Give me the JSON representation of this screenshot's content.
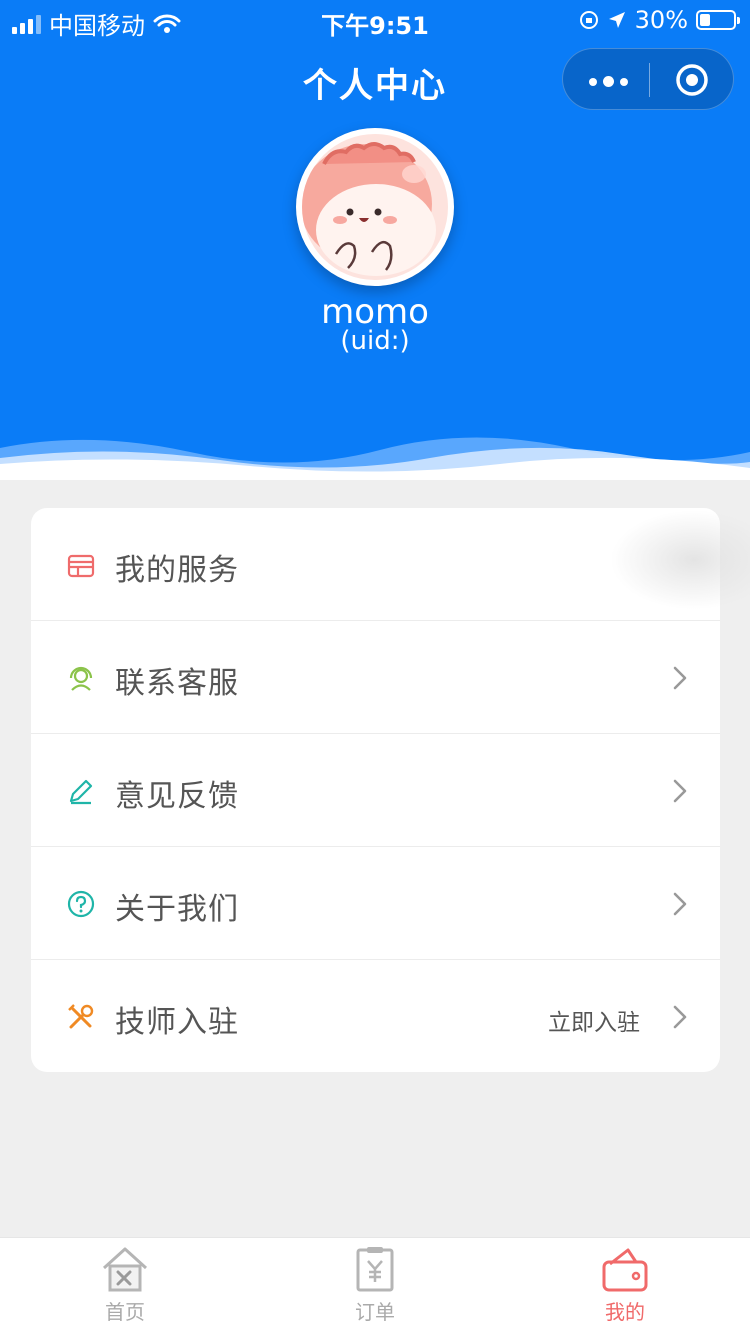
{
  "status_bar": {
    "carrier": "中国移动",
    "time": "下午9:51",
    "battery": "30%",
    "battery_level": 0.3
  },
  "nav": {
    "title": "个人中心"
  },
  "profile": {
    "username": "momo",
    "uid": "(uid:)"
  },
  "menu": [
    {
      "label": "我的服务",
      "icon": "store-icon",
      "color": "#ef6b6b"
    },
    {
      "label": "联系客服",
      "icon": "headset-icon",
      "color": "#8bc34a"
    },
    {
      "label": "意见反馈",
      "icon": "pencil-icon",
      "color": "#1fb5a8"
    },
    {
      "label": "关于我们",
      "icon": "question-icon",
      "color": "#1fb5a8"
    },
    {
      "label": "技师入驻",
      "icon": "tools-icon",
      "color": "#f08a24",
      "extra": "立即入驻"
    }
  ],
  "tabbar": [
    {
      "label": "首页",
      "icon": "home-tools-icon",
      "active": false
    },
    {
      "label": "订单",
      "icon": "order-receipt-icon",
      "active": false
    },
    {
      "label": "我的",
      "icon": "wallet-icon",
      "active": true
    }
  ],
  "colors": {
    "header_blue": "#0a7cf7",
    "active_tab": "#f06a6a"
  }
}
